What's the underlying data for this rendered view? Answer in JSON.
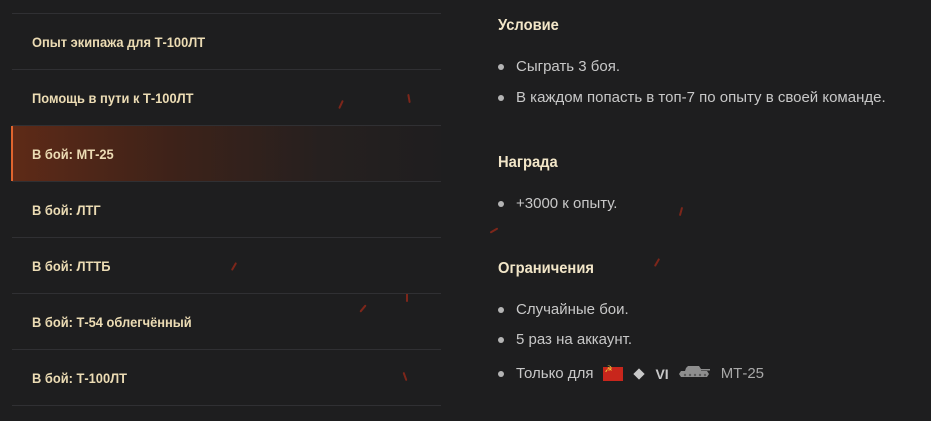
{
  "menu": {
    "items": [
      {
        "label": "Опыт экипажа для Т-100ЛТ",
        "active": false
      },
      {
        "label": "Помощь в пути к Т-100ЛТ",
        "active": false
      },
      {
        "label": "В бой: МТ-25",
        "active": true
      },
      {
        "label": "В бой: ЛТГ",
        "active": false
      },
      {
        "label": "В бой: ЛТТБ",
        "active": false
      },
      {
        "label": "В бой: Т-54 облегчённый",
        "active": false
      },
      {
        "label": "В бой: Т-100ЛТ",
        "active": false
      }
    ]
  },
  "details": {
    "condition": {
      "title": "Условие",
      "items": [
        "Сыграть 3 боя.",
        "В каждом попасть в топ-7 по опыту в своей команде."
      ]
    },
    "reward": {
      "title": "Награда",
      "items": [
        "+3000 к опыту."
      ]
    },
    "restrictions": {
      "title": "Ограничения",
      "items": [
        "Случайные бои.",
        "5 раз на аккаунт.",
        "Только для"
      ],
      "vehicle": {
        "nation_icon": "ussr-flag-icon",
        "class_icon": "medium-tank-diamond-icon",
        "tier": "VI",
        "tank_icon": "tank-silhouette-icon",
        "name": "МТ-25"
      }
    }
  },
  "colors": {
    "background": "#1e1e1f",
    "menu_text": "#ecdcb4",
    "active_accent": "#e0642e",
    "section_title": "#f2e6c8",
    "body_text": "#c8c8c8"
  }
}
